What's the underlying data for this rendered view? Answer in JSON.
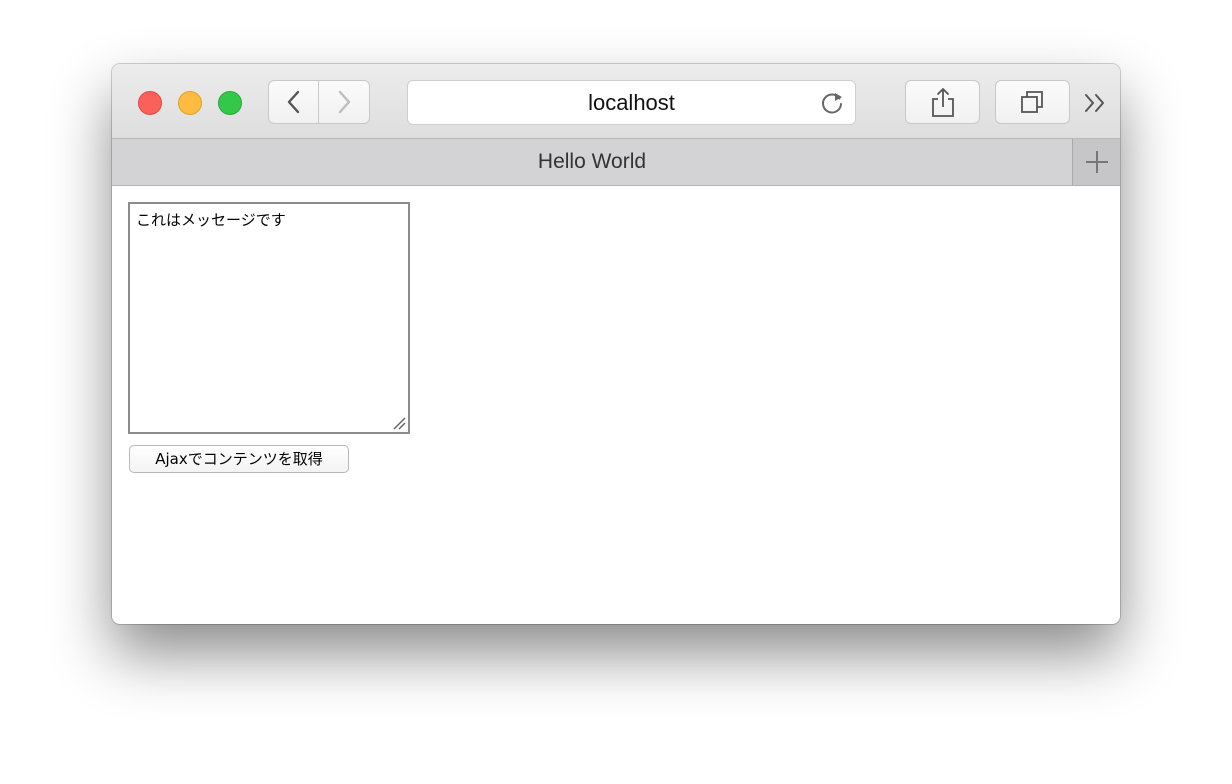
{
  "browser": {
    "address": "localhost",
    "tab_title": "Hello World",
    "icons": {
      "close": "close-icon",
      "minimize": "minimize-icon",
      "maximize": "maximize-icon",
      "back": "chevron-left-icon",
      "forward": "chevron-right-icon",
      "reload": "reload-icon",
      "share": "share-icon",
      "tabs": "tabs-icon",
      "overflow": "double-chevron-right-icon",
      "new_tab": "plus-icon"
    },
    "colors": {
      "close": "#fc605b",
      "minimize": "#fdbc40",
      "maximize": "#34c84a"
    }
  },
  "page": {
    "textarea_value": "これはメッセージです",
    "button_label": "Ajaxでコンテンツを取得"
  }
}
